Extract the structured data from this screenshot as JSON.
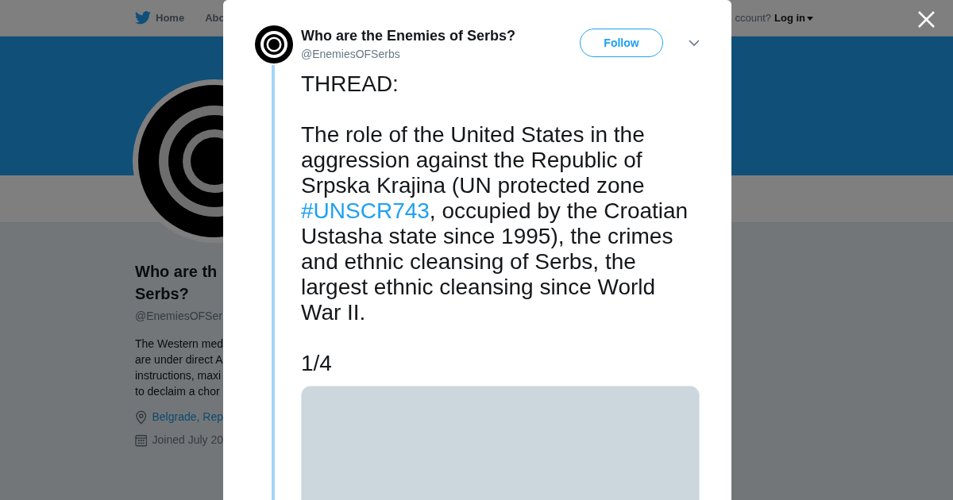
{
  "topnav": {
    "items": [
      {
        "label": "Home",
        "selected": false
      },
      {
        "label": "Abo",
        "selected": false
      }
    ],
    "account_prompt": "ccount?",
    "login": "Log in"
  },
  "profile": {
    "name_lines": [
      "Who are th",
      "Serbs?"
    ],
    "handle": "@EnemiesOFSer",
    "bio_lines": [
      "The Western med",
      "are under direct A",
      "instructions, maxi",
      "to declaim a chor"
    ],
    "location": "Belgrade, Rep",
    "joined": "Joined July 20"
  },
  "modal": {
    "author": {
      "name": "Who are the Enemies of Serbs?",
      "handle": "@EnemiesOFSerbs"
    },
    "follow": "Follow",
    "tweet": [
      {
        "segments": [
          {
            "kind": "text",
            "text": "THREAD:"
          }
        ]
      },
      {
        "segments": [
          {
            "kind": "text",
            "text": "The role of the United States in the aggression against the Republic of Srpska Krajina (UN protected zone "
          },
          {
            "kind": "hashtag",
            "text": "#UNSCR743"
          },
          {
            "kind": "text",
            "text": ", occupied by the Croatian Ustasha state since 1995), the crimes and ethnic cleansing of Serbs, the largest ethnic cleansing since World War II."
          }
        ]
      },
      {
        "segments": [
          {
            "kind": "text",
            "text": "1/4"
          }
        ]
      }
    ],
    "media": {
      "kind": "placeholder"
    }
  }
}
